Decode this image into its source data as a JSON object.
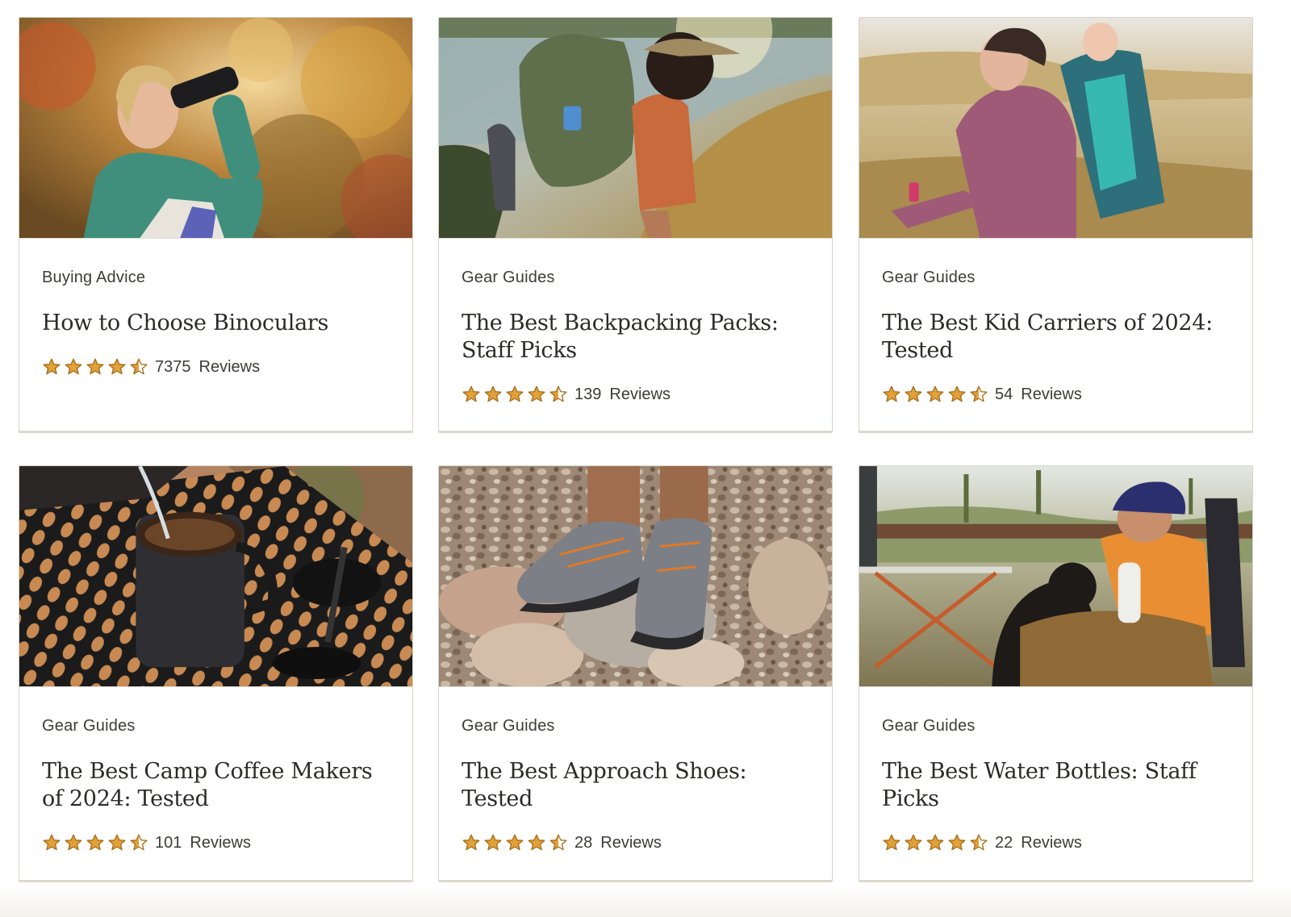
{
  "colors": {
    "star_fill": "#e0a03a",
    "star_stroke": "#a86b17",
    "text": "#3c3c38",
    "title": "#2b2b28",
    "border": "#d6d3c8"
  },
  "cards": [
    {
      "category": "Buying Advice",
      "title": "How to Choose Binoculars",
      "rating": 4.5,
      "review_count": "7375",
      "reviews_label": "Reviews",
      "image": "person-with-binoculars-autumn-trees"
    },
    {
      "category": "Gear Guides",
      "title": "The Best Backpacking Packs: Staff Picks",
      "rating": 4.5,
      "review_count": "139",
      "reviews_label": "Reviews",
      "image": "hikers-with-backpacks-lakeside"
    },
    {
      "category": "Gear Guides",
      "title": "The Best Kid Carriers of 2024: Tested",
      "rating": 4.5,
      "review_count": "54",
      "reviews_label": "Reviews",
      "image": "parent-with-child-carrier-grassland"
    },
    {
      "category": "Gear Guides",
      "title": "The Best Camp Coffee Makers of 2024: Tested",
      "rating": 4.5,
      "review_count": "101",
      "reviews_label": "Reviews",
      "image": "french-press-on-camp-table"
    },
    {
      "category": "Gear Guides",
      "title": "The Best Approach Shoes: Tested",
      "rating": 4.5,
      "review_count": "28",
      "reviews_label": "Reviews",
      "image": "approach-shoes-on-rocks"
    },
    {
      "category": "Gear Guides",
      "title": "The Best Water Bottles: Staff Picks",
      "rating": 4.5,
      "review_count": "22",
      "reviews_label": "Reviews",
      "image": "man-with-dog-and-water-bottle-desert"
    }
  ]
}
